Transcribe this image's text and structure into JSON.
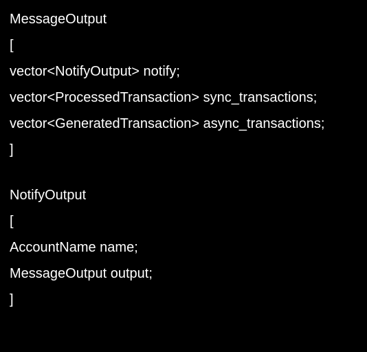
{
  "block1": {
    "title": "MessageOutput",
    "open": "[",
    "line1": "vector<NotifyOutput> notify;",
    "line2": "vector<ProcessedTransaction> sync_transactions;",
    "line3": "vector<GeneratedTransaction> async_transactions;",
    "close": "]"
  },
  "block2": {
    "title": "NotifyOutput",
    "open": "[",
    "line1": "AccountName name;",
    "line2": "MessageOutput output;",
    "close": "]"
  }
}
